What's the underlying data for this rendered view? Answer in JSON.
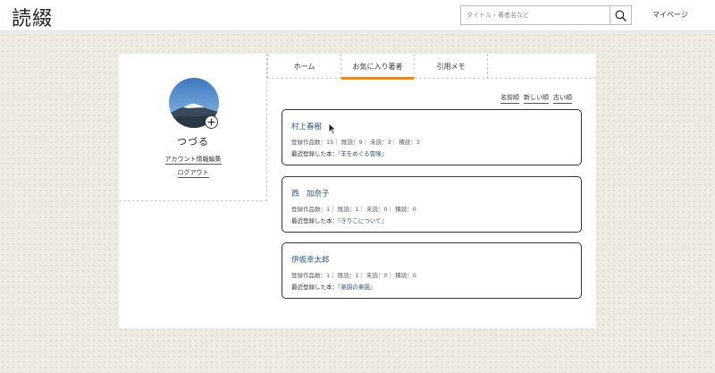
{
  "header": {
    "logo": "読綴",
    "search_placeholder": "タイトル・著者名など",
    "mypage_label": "マイページ"
  },
  "profile": {
    "username": "つづる",
    "edit_account_label": "アカウント情報編集",
    "logout_label": "ログアウト"
  },
  "tabs": [
    {
      "label": "ホーム",
      "active": false
    },
    {
      "label": "お気に入り著者",
      "active": true
    },
    {
      "label": "引用メモ",
      "active": false
    }
  ],
  "sort": [
    "名前順",
    "新しい順",
    "古い順"
  ],
  "authors": [
    {
      "name": "村上春樹",
      "stats": "登録作品数：15｜ 既読：9｜ 未読：3｜ 積読：3",
      "recent_label": "最近登録した本：",
      "recent_book": "『羊をめぐる冒険』"
    },
    {
      "name": "西　加奈子",
      "stats": "登録作品数：1｜ 既読：1｜ 未読：0｜ 積読：0",
      "recent_label": "最近登録した本：",
      "recent_book": "『きりこについて』"
    },
    {
      "name": "伊坂幸太郎",
      "stats": "登録作品数：1｜ 既読：1｜ 未読：0｜ 積読：0",
      "recent_label": "最近登録した本：",
      "recent_book": "『楽園の楽園』"
    }
  ],
  "colors": {
    "accent": "#e08a2c",
    "link": "#2d4f7c"
  }
}
